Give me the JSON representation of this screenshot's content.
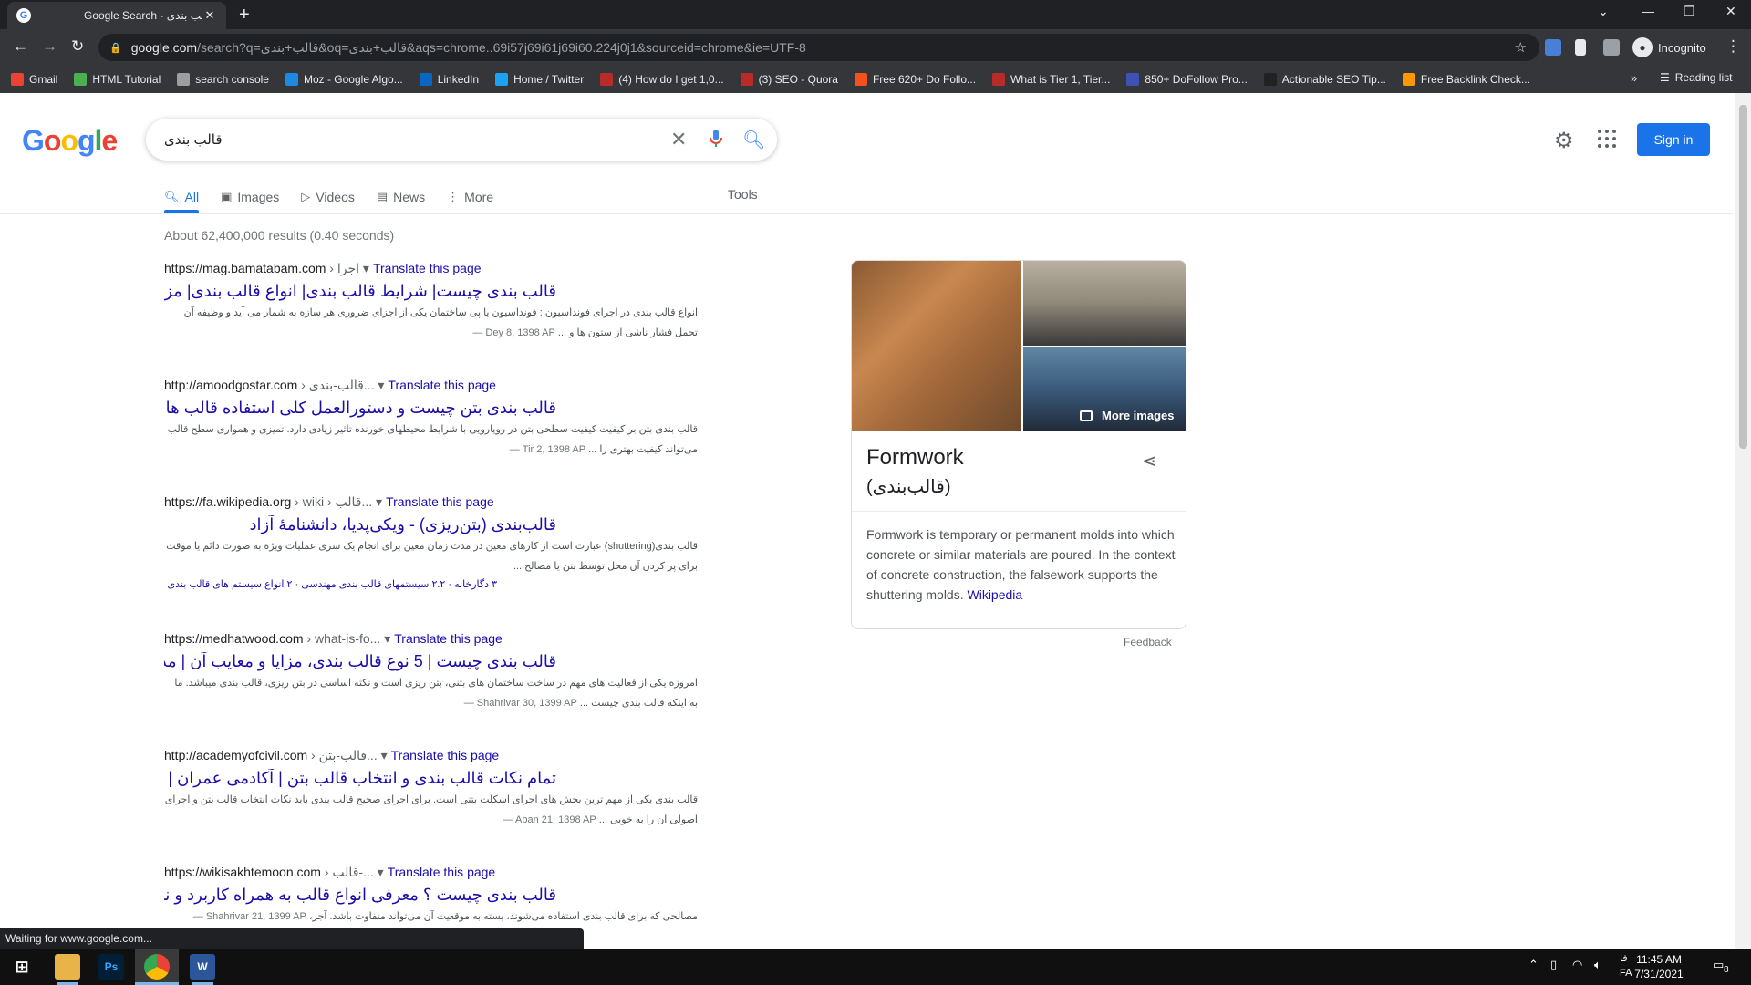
{
  "browser": {
    "tab_title": "Google Search - قالب بندی",
    "url_host": "google.com",
    "url_rest": "/search?q=قالب+بندی&oq=قالب+بندی&aqs=chrome..69i57j69i61j69i60.224j0j1&sourceid=chrome&ie=UTF-8",
    "profile_label": "Incognito",
    "bookmarks": [
      {
        "label": "Gmail",
        "color": "#ea4335"
      },
      {
        "label": "HTML Tutorial",
        "color": "#4caf50"
      },
      {
        "label": "search console",
        "color": "#9e9e9e"
      },
      {
        "label": "Moz - Google Algo...",
        "color": "#1e88e5"
      },
      {
        "label": "LinkedIn",
        "color": "#0a66c2"
      },
      {
        "label": "Home / Twitter",
        "color": "#1da1f2"
      },
      {
        "label": "(4) How do I get 1,0...",
        "color": "#b92b27"
      },
      {
        "label": "(3) SEO - Quora",
        "color": "#b92b27"
      },
      {
        "label": "Free 620+ Do Follo...",
        "color": "#f4511e"
      },
      {
        "label": "What is Tier 1, Tier...",
        "color": "#b92b27"
      },
      {
        "label": "850+ DoFollow Pro...",
        "color": "#3f51b5"
      },
      {
        "label": "Actionable SEO Tip...",
        "color": "#212121"
      },
      {
        "label": "Free Backlink Check...",
        "color": "#ff9800"
      }
    ],
    "more_bookmarks": "»",
    "reading_list": "Reading list",
    "status_text": "Waiting for www.google.com..."
  },
  "google": {
    "logo": [
      "G",
      "o",
      "o",
      "g",
      "l",
      "e"
    ],
    "logo_colors": [
      "#4285f4",
      "#ea4335",
      "#fbbc05",
      "#4285f4",
      "#34a853",
      "#ea4335"
    ],
    "query": "قالب بندی",
    "signin_label": "Sign in",
    "tabs": [
      "All",
      "Images",
      "Videos",
      "News",
      "More"
    ],
    "tools_label": "Tools",
    "stats": "About 62,400,000 results (0.40 seconds)",
    "results": [
      {
        "site": "https://mag.bamatabam.com",
        "crumb": " › اجرا",
        "translate": "Translate this page",
        "title": "قالب بندی چیست| شرایط قالب بندی| انواع قالب بندی| مزایا و ...",
        "date": "Dey 8, 1398 AP — ",
        "snippet": "انواع قالب بندی در اجرای فونداسیون : فونداسیون یا پی ساختمان یکی از اجزای ضروری هر سازه به شمار می آید و وظیفه آن تحمل فشار ناشی از ستون ها و ..."
      },
      {
        "site": "http://amoodgostar.com",
        "crumb": " › قالب-بندی...",
        "translate": "Translate this page",
        "title": "قالب بندی بتن چیست و دستورالعمل کلی استفاده قالب ها ...",
        "date": "Tir 2, 1398 AP — ",
        "snippet": "قالب بندی بتن بر کیفیت کیفیت سطحی بتن در رویارویی با شرایط محیطهای خورنده تاثیر زیادی دارد. تمیزی و همواری سطح قالب می‌تواند کیفیت بهتری را ..."
      },
      {
        "site": "https://fa.wikipedia.org",
        "crumb": " › wiki › قالب...",
        "translate": "Translate this page",
        "title": "قالب‌بندی (بتن‌ریزی) - ویکی‌پدیا، دانشنامهٔ آزاد",
        "date": "",
        "snippet": "قالب بندی(shuttering) عبارت است از کارهای معین در مدت زمان معین برای انجام یک سری عملیات ویژه به صورت دائم یا موقت برای پر کردن آن محل توسط بتن یا مصالح ...",
        "sitelinks": "۳ دگارخانه · ۲.۲ سیستمهای قالب بندی مهندسی · ۲ انواع سیستم های قالب بندی"
      },
      {
        "site": "https://medhatwood.com",
        "crumb": " › what-is-fo...",
        "translate": "Translate this page",
        "title": "قالب بندی چیست | 5 نوع قالب بندی، مزایا و معایب آن | مدحت",
        "date": "Shahrivar 30, 1399 AP — ",
        "snippet": "امروزه یکی از فعالیت های مهم در ساخت ساختمان های بتنی، بتن ریزی است و نکته اساسی در بتن ریزی، قالب بندی میباشد. ما به اینکه قالب بندی چیست ..."
      },
      {
        "site": "http://academyofcivil.com",
        "crumb": " › قالب-بتن...",
        "translate": "Translate this page",
        "title": "تمام نکات قالب بندی و انتخاب قالب بتن | آکادمی عمران | مرکز ...",
        "date": "Aban 21, 1398 AP — ",
        "snippet": "قالب بندی یکی از مهم ترین بخش های اجرای اسکلت بتنی است. برای اجرای صحیح قالب بندی باید نکات انتخاب قالب بتن و اجرای اصولی آن را به خوبی ..."
      },
      {
        "site": "https://wikisakhtemoon.com",
        "crumb": " › قالب-...",
        "translate": "Translate this page",
        "title": "قالب بندی چیست ؟ معرفی انواع قالب به همراه کاربرد و نحوه اجرا ...",
        "date": "Shahrivar 21, 1399 AP — ",
        "snippet": "مصالحی که برای قالب بندی استفاده می‌شوند، بسته به موقعیت آن می‌تواند متفاوت باشد. آجر،"
      }
    ],
    "knowledge_panel": {
      "more_images": "More images",
      "title": "Formwork",
      "subtitle": "(قالب‌بندی)",
      "description": "Formwork is temporary or permanent molds into which concrete or similar materials are poured. In the context of concrete construction, the falsework supports the shuttering molds.",
      "source": "Wikipedia",
      "feedback": "Feedback"
    }
  },
  "taskbar": {
    "apps": [
      {
        "label": "Ps",
        "color": "#001e36"
      },
      {
        "label": "W",
        "color": "#2b579a"
      }
    ],
    "language": "FA",
    "language_short": "فا",
    "time": "11:45 AM",
    "date": "7/31/2021",
    "notification_count": "8"
  }
}
